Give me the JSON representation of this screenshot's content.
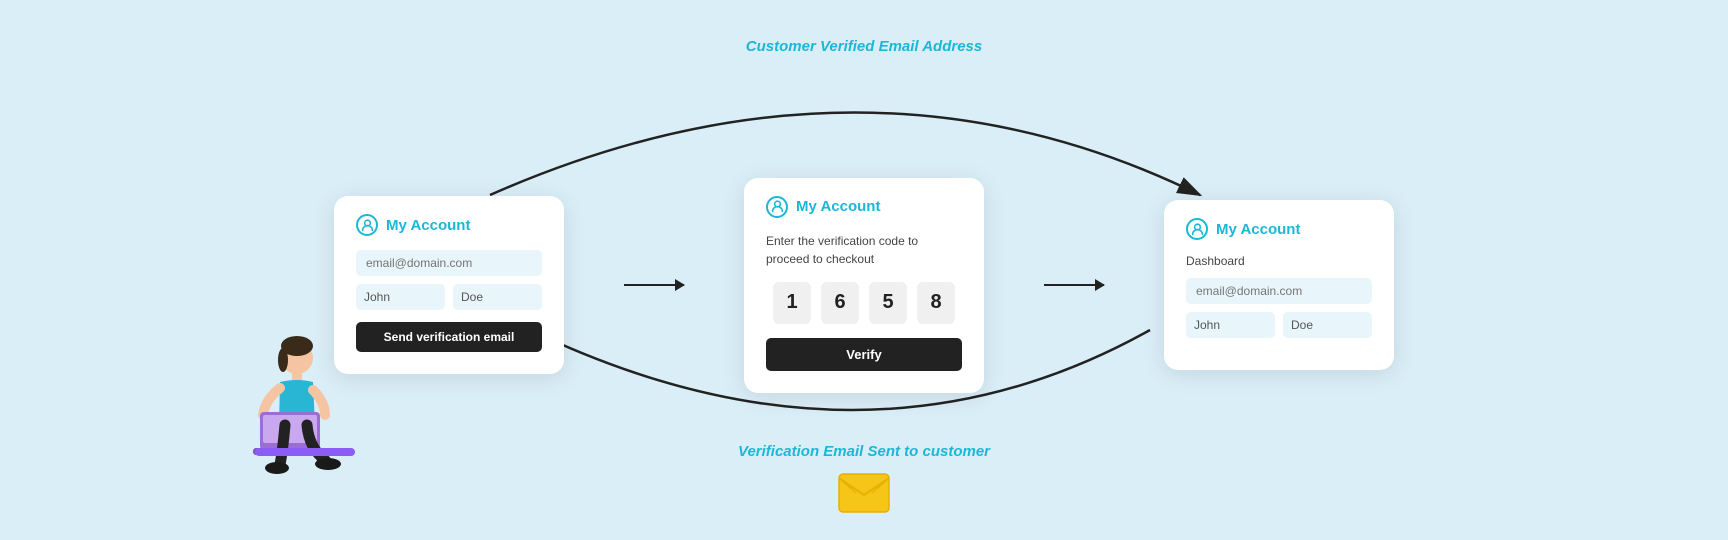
{
  "page": {
    "background": "#daeef8",
    "top_label": "Customer Verified Email Address",
    "bottom_label": "Verification Email Sent to customer"
  },
  "card1": {
    "title": "My Account",
    "email_placeholder": "email@domain.com",
    "first_name": "John",
    "last_name": "Doe",
    "button_label": "Send verification email"
  },
  "card2": {
    "title": "My Account",
    "description": "Enter the verification code to proceed to checkout",
    "code_digits": [
      "1",
      "6",
      "5",
      "8"
    ],
    "button_label": "Verify"
  },
  "card3": {
    "title": "My Account",
    "dashboard_label": "Dashboard",
    "email_placeholder": "email@domain.com",
    "first_name": "John",
    "last_name": "Doe"
  },
  "arrows": {
    "top_text": "Customer Verified Email Address",
    "bottom_text": "Verification Email Sent to customer"
  }
}
